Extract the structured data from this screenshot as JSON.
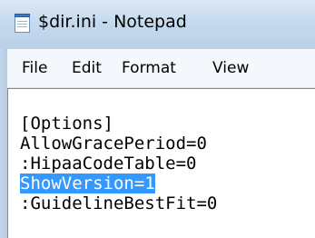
{
  "window": {
    "title": "$dir.ini - Notepad",
    "icon": "notepad-icon"
  },
  "menubar": {
    "items": [
      "File",
      "Edit",
      "Format",
      "View"
    ]
  },
  "editor": {
    "lines": [
      "[Options]",
      "AllowGracePeriod=0",
      ":HipaaCodeTable=0",
      "ShowVersion=1",
      ":GuidelineBestFit=0"
    ],
    "selected_line": "ShowVersion=1",
    "selection_color": "#3399ff"
  }
}
